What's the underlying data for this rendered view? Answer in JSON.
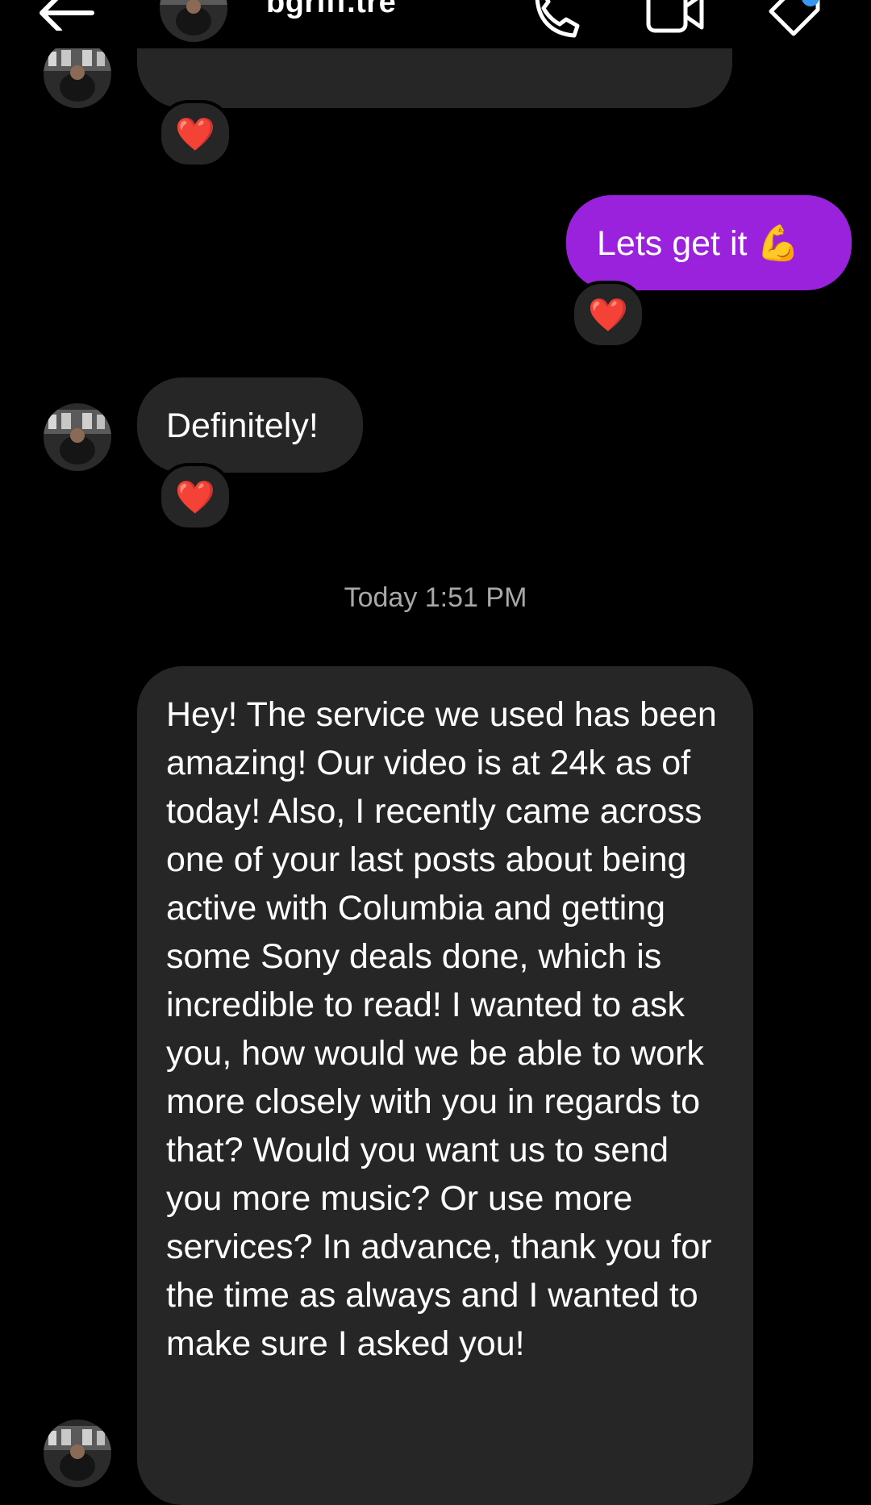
{
  "header": {
    "username": "bgriff.tre",
    "back_icon": "arrow-left-icon",
    "call_icon": "phone-icon",
    "video_icon": "video-camera-icon",
    "tag_icon": "tag-icon",
    "notification_color": "#3897f0"
  },
  "colors": {
    "background": "#000000",
    "incoming_bubble": "#262626",
    "outgoing_bubble": "#9b22dc",
    "timestamp_text": "#a8a8a8",
    "reaction_heart": "#ff3b61"
  },
  "messages": [
    {
      "id": "m1",
      "direction": "incoming",
      "text": "",
      "reaction": "❤️"
    },
    {
      "id": "m2",
      "direction": "outgoing",
      "text": "Lets get it 💪",
      "reaction": "❤️"
    },
    {
      "id": "m3",
      "direction": "incoming",
      "text": "Definitely!",
      "reaction": "❤️"
    },
    {
      "id": "m4",
      "direction": "incoming",
      "text": "Hey! The service we used has been amazing! Our video is at 24k as of today! Also, I recently came across one of your last posts about being active with Columbia and getting some Sony deals done, which is incredible to read! I wanted to ask you, how would we be able to work more closely with you in regards to that? Would you want us to send you more music? Or use more services? In advance, thank you for the time as always and I wanted to make sure I asked you!"
    }
  ],
  "timestamp": "Today 1:51 PM"
}
